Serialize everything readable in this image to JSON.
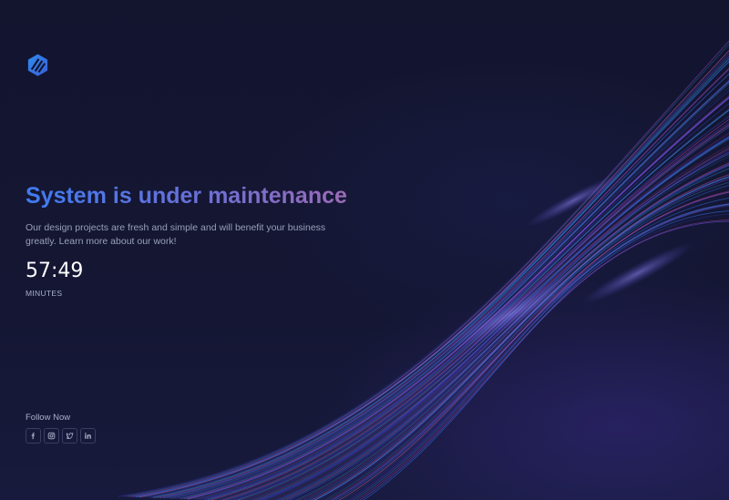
{
  "brand": {
    "logo_icon": "hexagon-logo-icon",
    "accent": "#3f7bf0"
  },
  "maintenance": {
    "title": "System is under maintenance",
    "description": "Our design projects are fresh and simple and will benefit your business greatly. Learn more about our work!",
    "countdown": {
      "value": "57:49",
      "label": "MINUTES"
    }
  },
  "footer": {
    "follow_label": "Follow Now",
    "social": [
      {
        "name": "facebook",
        "icon": "facebook-icon"
      },
      {
        "name": "instagram",
        "icon": "instagram-icon"
      },
      {
        "name": "twitter",
        "icon": "twitter-icon"
      },
      {
        "name": "linkedin",
        "icon": "linkedin-icon"
      }
    ]
  },
  "colors": {
    "background": "#12142e",
    "gradient_start": "#3f7bf0",
    "gradient_end": "#b06aa8",
    "text_muted": "#9aa0b8"
  }
}
